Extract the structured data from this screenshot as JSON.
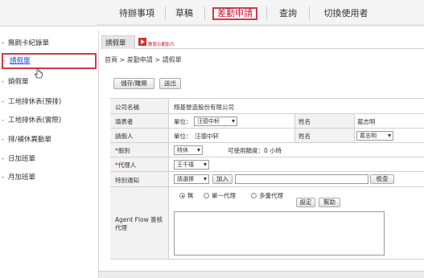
{
  "topnav": {
    "items": [
      {
        "label": "待辦事項"
      },
      {
        "label": "草稿"
      },
      {
        "label": "差勤申請",
        "active": true
      },
      {
        "label": "查詢"
      },
      {
        "label": "切換使用者"
      }
    ]
  },
  "sidebar": {
    "items": [
      {
        "label": "無刷卡紀錄單"
      },
      {
        "label": "請假單",
        "active": true
      },
      {
        "label": "銷假單"
      },
      {
        "label": "工地排休表(預排)"
      },
      {
        "label": "工地排休表(實際)"
      },
      {
        "label": "排/補休異動單"
      },
      {
        "label": "日加班單"
      },
      {
        "label": "月加班單"
      }
    ]
  },
  "tab": {
    "title": "請假單",
    "video_link": "教學示範影片"
  },
  "breadcrumb": "首頁 > 差勤申請 > 請假單",
  "toolbar": {
    "save_leave_label": "儲存/離開",
    "leave_label": "送出"
  },
  "form": {
    "company_label": "公司名稱",
    "company_value": "翔基營造股份有限公司",
    "filler_label": "填表者",
    "filler_unit": "單位：",
    "filler_unit_value": "汪德中轩",
    "filler_name_label": "姓名",
    "filler_name_value": "葛志明",
    "applicant_label": "請假人",
    "applicant_unit": "單位：",
    "applicant_unit_value": "汪德中轩",
    "applicant_name_label": "姓名",
    "applicant_name_value": "葛志明",
    "leave_type_label": "假別",
    "leave_type_value": "特休",
    "available_text": "可使用額度：0 小時",
    "agent_label": "代理人",
    "agent_value": "王千禧",
    "notify_label": "特別通知",
    "notify_select": "請選擇",
    "add_label": "加入",
    "check_label": "檢查",
    "flow_label": "Agent Flow 簽核代理",
    "radio_none": "無",
    "radio_single": "單一代理",
    "radio_multi": "多重代理",
    "settings_label": "設定",
    "help_label": "幫助"
  }
}
